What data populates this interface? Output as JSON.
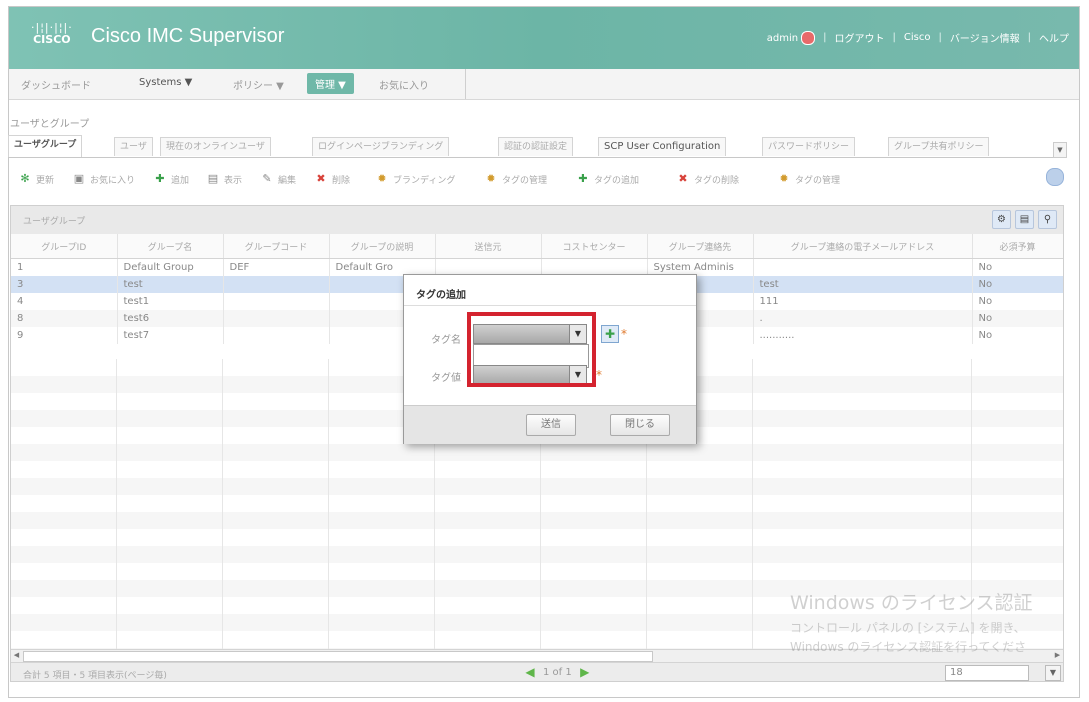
{
  "header": {
    "logo_bars": "·|¦|·|¦|·",
    "logo_text": "CISCO",
    "title": "Cisco IMC Supervisor",
    "user": "admin",
    "links": [
      "ログアウト",
      "Cisco",
      "バージョン情報",
      "ヘルプ"
    ],
    "separator": "|"
  },
  "menubar": {
    "items": [
      "ダッシュボード",
      "Systems ▼",
      "ポリシー ▼",
      "管理 ▼",
      "お気に入り"
    ]
  },
  "breadcrumb": "ユーザとグループ",
  "tabs": [
    "ユーザグループ",
    "ユーザ",
    "現在のオンラインユーザ",
    "ログインページブランディング",
    "認証の認証設定",
    "SCP User Configuration",
    "パスワードポリシー",
    "グループ共有ポリシー"
  ],
  "toolbar": {
    "items": [
      "更新",
      "お気に入り",
      "追加",
      "表示",
      "編集",
      "削除",
      "ブランディング",
      "タグの管理",
      "タグの追加",
      "タグの削除",
      "タグの管理"
    ]
  },
  "panel": {
    "title": "ユーザグループ",
    "columns": [
      "グループID",
      "グループ名",
      "グループコード",
      "グループの説明",
      "送信元",
      "コストセンター",
      "グループ連絡先",
      "グループ連絡の電子メールアドレス",
      "必須予算"
    ],
    "rows": [
      [
        "1",
        "Default Group",
        "DEF",
        "Default Gro",
        "",
        "",
        "System Adminis",
        "",
        "No"
      ],
      [
        "3",
        "test",
        "",
        "",
        "",
        "",
        "",
        "test",
        "No"
      ],
      [
        "4",
        "test1",
        "",
        "",
        "",
        "",
        "",
        "111",
        "No"
      ],
      [
        "8",
        "test6",
        "",
        "",
        "",
        "",
        "",
        ".",
        "No"
      ],
      [
        "9",
        "test7",
        "",
        "",
        "",
        "",
        "",
        "...........",
        "No"
      ]
    ],
    "selected_row_index": 1
  },
  "footer": {
    "summary": "合計 5 項目・5 項目表示(ページ毎)",
    "pager": "1 of 1",
    "page_size": "18"
  },
  "modal": {
    "title": "タグの追加",
    "tag_name_label": "タグ名",
    "tag_value_label": "タグ値",
    "tag_name_value": "",
    "tag_value_value": "",
    "submit_label": "送信",
    "close_label": "閉じる",
    "required_mark": "*"
  },
  "watermark": {
    "line1": "Windows のライセンス認証",
    "line2": "コントロール パネルの [システム] を開き、",
    "line3": "Windows のライセンス認証を行ってくださ"
  },
  "colors": {
    "header": "#6cb5a6",
    "active_menu": "#6fb8a8",
    "selected_row": "#d3e1f4",
    "highlight": "#d4232f"
  }
}
